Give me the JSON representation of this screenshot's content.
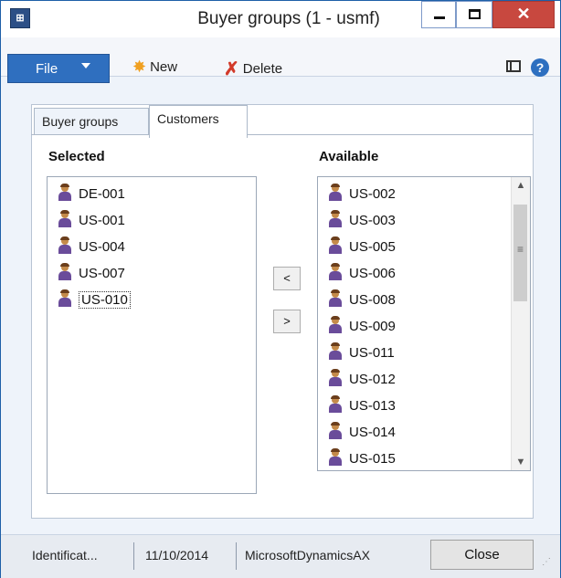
{
  "window": {
    "title": "Buyer groups (1 - usmf)",
    "app_icon": "dynamics-app-icon"
  },
  "toolbar": {
    "file_label": "File",
    "new_label": "New",
    "delete_label": "Delete"
  },
  "tabs": [
    {
      "label": "Buyer groups",
      "active": false
    },
    {
      "label": "Customers",
      "active": true
    }
  ],
  "selected": {
    "label": "Selected",
    "items": [
      "DE-001",
      "US-001",
      "US-004",
      "US-007",
      "US-010"
    ],
    "focused_index": 4
  },
  "available": {
    "label": "Available",
    "items": [
      "US-002",
      "US-003",
      "US-005",
      "US-006",
      "US-008",
      "US-009",
      "US-011",
      "US-012",
      "US-013",
      "US-014",
      "US-015"
    ]
  },
  "move_buttons": {
    "to_selected": "<",
    "to_available": ">"
  },
  "status_bar": {
    "identification": "Identificat...",
    "date": "11/10/2014",
    "company": "MicrosoftDynamicsAX",
    "close_label": "Close"
  },
  "colors": {
    "file_button": "#2f6fbf",
    "close_button": "#c8483f",
    "window_border": "#1e5fa8"
  }
}
